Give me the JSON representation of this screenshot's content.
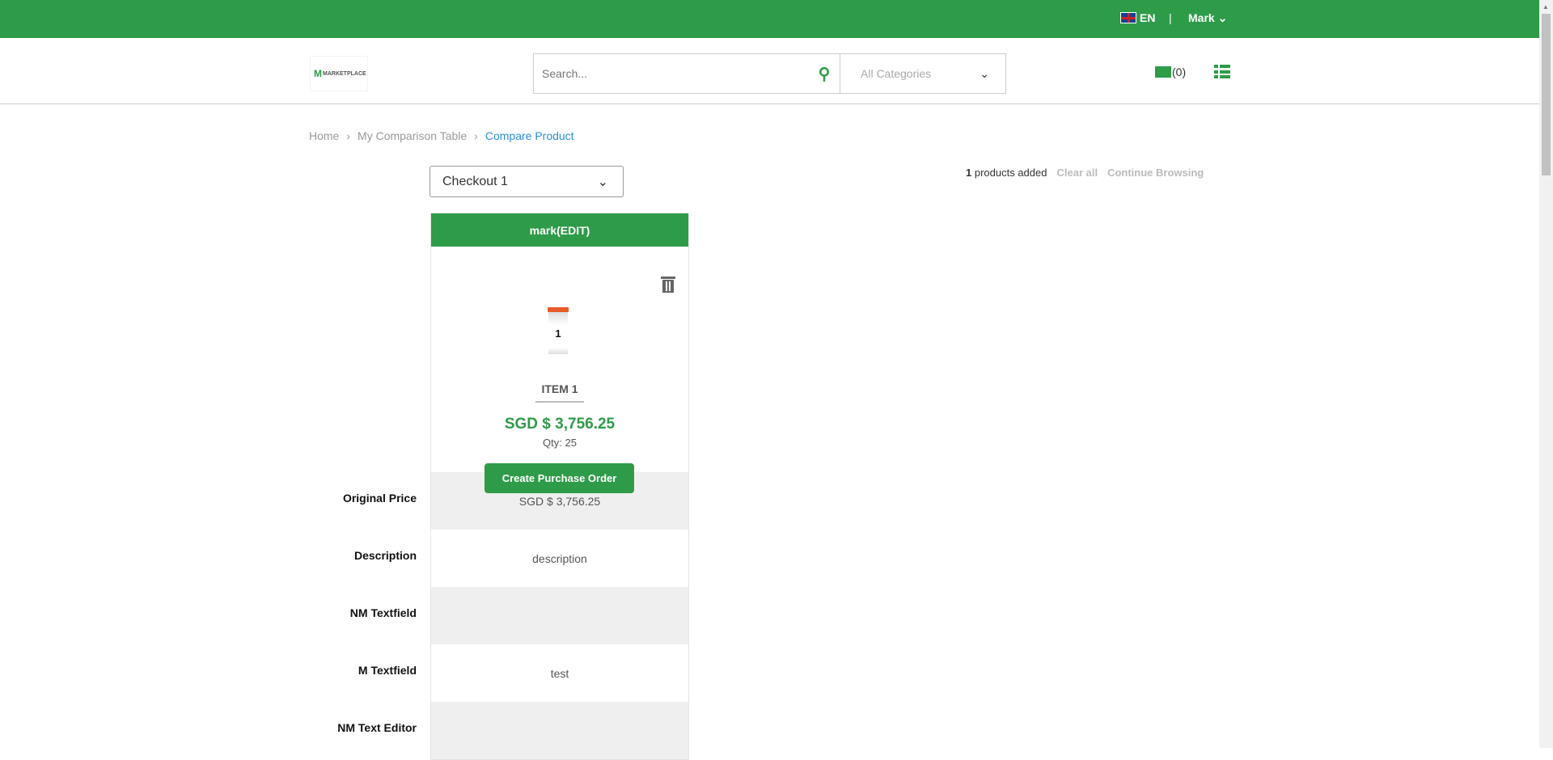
{
  "topbar": {
    "language": "EN",
    "separator": "|",
    "user": "Mark"
  },
  "header": {
    "logo_text": "MARKETPLACE",
    "search_placeholder": "Search...",
    "category": "All Categories",
    "messages_count": "(0)"
  },
  "breadcrumb": [
    "Home",
    "My Comparison Table",
    "Compare Product"
  ],
  "checkout_select": "Checkout 1",
  "summary": {
    "count": "1",
    "added_label": "products added",
    "clear_all": "Clear all",
    "continue": "Continue Browsing"
  },
  "column": {
    "header": "mark(EDIT)",
    "vial_label": "1",
    "item_name": "ITEM 1",
    "price": "SGD $ 3,756.25",
    "qty": "Qty: 25",
    "po_button": "Create Purchase Order"
  },
  "rows": [
    {
      "label": "Original Price",
      "value": "SGD $ 3,756.25"
    },
    {
      "label": "Description",
      "value": "description"
    },
    {
      "label": "NM Textfield",
      "value": ""
    },
    {
      "label": "M Textfield",
      "value": "test"
    },
    {
      "label": "NM Text Editor",
      "value": ""
    }
  ]
}
